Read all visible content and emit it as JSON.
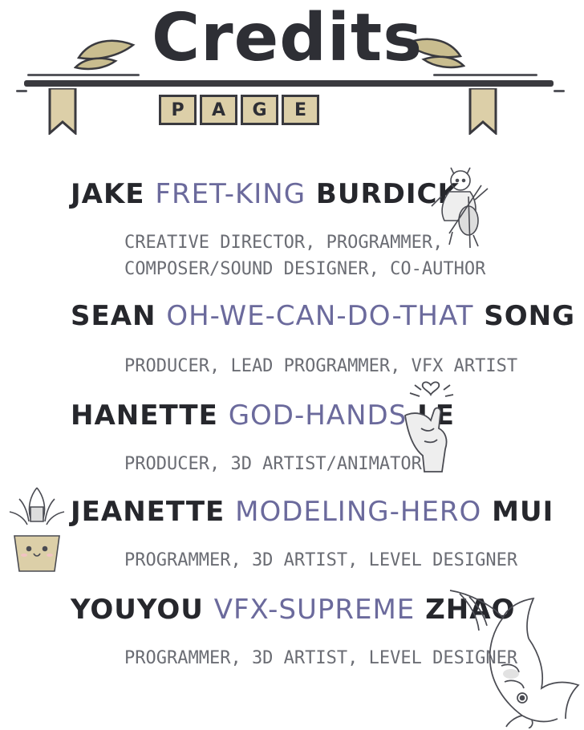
{
  "header": {
    "title": "Credits",
    "subtitle_letters": [
      "P",
      "A",
      "G",
      "E"
    ]
  },
  "credits": [
    {
      "first": "JAKE",
      "nickname": "FRET-KING",
      "last": "BURDICK",
      "role_lines": [
        "CREATIVE DIRECTOR, PROGRAMMER,",
        "COMPOSER/SOUND DESIGNER, CO-AUTHOR"
      ]
    },
    {
      "first": "SEAN",
      "nickname": "OH-WE-CAN-DO-THAT",
      "last": "SONG",
      "role_lines": [
        "PRODUCER, LEAD PROGRAMMER, VFX ARTIST"
      ]
    },
    {
      "first": "HANETTE",
      "nickname": "GOD-HANDS",
      "last": "LE",
      "role_lines": [
        "PRODUCER, 3D ARTIST/ANIMATOR"
      ]
    },
    {
      "first": "JEANETTE",
      "nickname": "MODELING-HERO",
      "last": "MUI",
      "role_lines": [
        "PROGRAMMER, 3D ARTIST, LEVEL DESIGNER"
      ]
    },
    {
      "first": "YOUYOU",
      "nickname": "VFX-SUPREME",
      "last": "ZHAO",
      "role_lines": [
        "PROGRAMMER, 3D ARTIST, LEVEL DESIGNER"
      ]
    }
  ],
  "illustrations": [
    "cellist-sketch-icon",
    "finger-heart-hand-icon",
    "succulent-pot-icon",
    "koi-fish-icon"
  ],
  "colors": {
    "ink": "#26272c",
    "nickname": "#6b6a9c",
    "role": "#6b6d74",
    "tile": "#dccfa8",
    "leaf": "#c9bd8f"
  }
}
